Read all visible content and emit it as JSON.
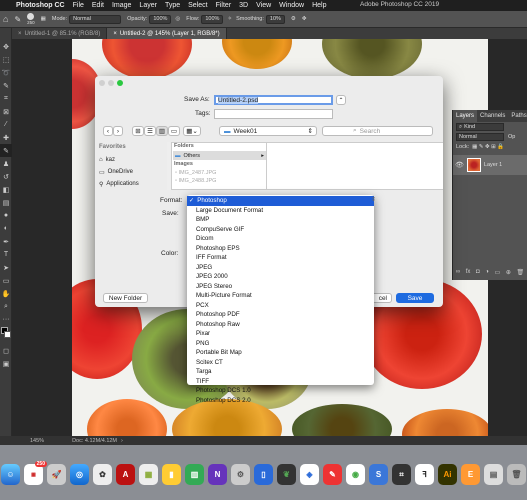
{
  "menubar": {
    "apple": "",
    "app": "Photoshop CC",
    "items": [
      "File",
      "Edit",
      "Image",
      "Layer",
      "Type",
      "Select",
      "Filter",
      "3D",
      "View",
      "Window",
      "Help"
    ],
    "window_title": "Adobe Photoshop CC 2019"
  },
  "options": {
    "brush_size": "250",
    "mode_label": "Mode:",
    "mode_value": "Normal",
    "opacity_label": "Opacity:",
    "opacity_value": "100%",
    "flow_label": "Flow:",
    "flow_value": "100%",
    "smoothing_label": "Smoothing:",
    "smoothing_value": "10%"
  },
  "tabs": [
    {
      "label": "Untitled-1 @ 85.1% (RGB/8)"
    },
    {
      "label": "Untitled-2 @ 145% (Layer 1, RGB/8*)"
    }
  ],
  "status": {
    "zoom": "145%",
    "doc": "Doc: 4.12M/4.12M"
  },
  "layers_panel": {
    "tabs": [
      "Layers",
      "Channels",
      "Paths"
    ],
    "filter": "Kind",
    "blend": "Normal",
    "opacity_short": "Op",
    "lock_label": "Lock:",
    "layer_name": "Layer 1",
    "footer": "fx"
  },
  "dialog": {
    "save_as_label": "Save As:",
    "save_as_value": "Untitled-2.psd",
    "tags_label": "Tags:",
    "location": "Week01",
    "search_placeholder": "Search",
    "favorites_header": "Favorites",
    "favorites": [
      "kaz",
      "OneDrive",
      "Applications"
    ],
    "folders_header": "Folders",
    "folders": [
      "Others"
    ],
    "images_header": "Images",
    "images": [
      "IMG_2487.JPG",
      "IMG_2488.JPG"
    ],
    "format_label": "Format:",
    "save_label": "Save:",
    "color_label": "Color:",
    "new_folder": "New Folder",
    "cancel": "Cancel",
    "cancel_visible": "cel",
    "save_button": "Save"
  },
  "format_options": [
    "Photoshop",
    "Large Document Format",
    "BMP",
    "CompuServe GIF",
    "Dicom",
    "Photoshop EPS",
    "IFF Format",
    "JPEG",
    "JPEG 2000",
    "JPEG Stereo",
    "Multi-Picture Format",
    "PCX",
    "Photoshop PDF",
    "Photoshop Raw",
    "Pixar",
    "PNG",
    "Portable Bit Map",
    "Scitex CT",
    "Targa",
    "TIFF",
    "Photoshop DCS 1.0",
    "Photoshop DCS 2.0"
  ],
  "format_selected": "Photoshop",
  "checkmark": "✓",
  "dock": {
    "badge": "250"
  }
}
